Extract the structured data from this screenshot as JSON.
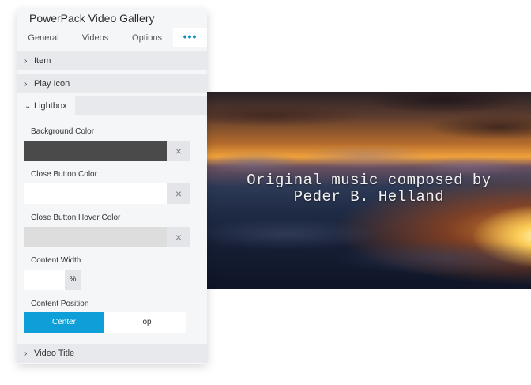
{
  "panel": {
    "title": "PowerPack Video Gallery",
    "tabs": [
      {
        "label": "General"
      },
      {
        "label": "Videos"
      },
      {
        "label": "Options"
      }
    ],
    "more_label": "•••",
    "sections": {
      "item": "Item",
      "play_icon": "Play Icon",
      "lightbox": "Lightbox",
      "video_title": "Video Title"
    },
    "lightbox": {
      "background_color_label": "Background Color",
      "background_color_value": "#4a4a4a",
      "close_button_color_label": "Close Button Color",
      "close_button_color_value": "#ffffff",
      "close_button_hover_color_label": "Close Button Hover Color",
      "close_button_hover_color_value": "#dddddd",
      "clear_icon": "×",
      "content_width_label": "Content Width",
      "content_width_value": "",
      "content_width_unit": "%",
      "content_position_label": "Content Position",
      "content_position_options": [
        "Center",
        "Top"
      ],
      "content_position_selected": "Center"
    }
  },
  "video": {
    "caption": "Original music composed by\nPeder B. Helland"
  },
  "colors": {
    "accent": "#0e9fd8",
    "panel_bg": "#f5f6f8",
    "section_bg": "#e7e9ec"
  }
}
